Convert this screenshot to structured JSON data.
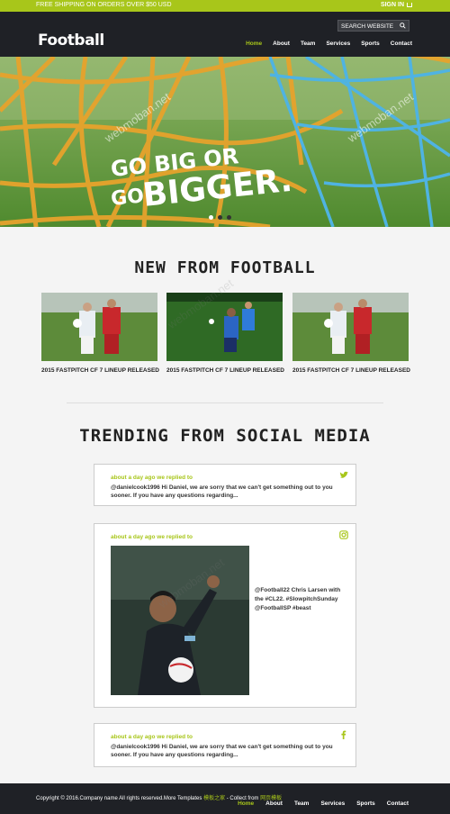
{
  "topbar": {
    "shipping": "FREE SHIPPING ON ORDERS OVER $50 USD",
    "signin": "SIGN IN"
  },
  "header": {
    "logo": "Football",
    "search_placeholder": "SEARCH WEBSITE",
    "nav": [
      "Home",
      "About",
      "Team",
      "Services",
      "Sports",
      "Contact"
    ]
  },
  "hero": {
    "line1": "GO BIG OR",
    "line2a": "GO",
    "line2b": "BIGGER."
  },
  "news": {
    "title": "NEW FROM FOOTBALL",
    "items": [
      {
        "caption": "2015 FASTPITCH CF 7 LINEUP RELEASED"
      },
      {
        "caption": "2015 FASTPITCH CF 7 LINEUP RELEASED"
      },
      {
        "caption": "2015 FASTPITCH CF 7 LINEUP RELEASED"
      }
    ]
  },
  "social": {
    "title": "TRENDING FROM SOCIAL MEDIA",
    "posts": [
      {
        "meta": "about a day ago we replied to",
        "text": "@danielcook1996 Hi Daniel, we are sorry that we can't get something out to you sooner. If you have any questions regarding...",
        "icon": "twitter-icon"
      },
      {
        "meta": "about a day ago we replied to",
        "text": "@Football22 Chris Larsen with the #CL22. #SlowpitchSunday @FootballSP #beast",
        "icon": "instagram-icon"
      },
      {
        "meta": "about a day ago we replied to",
        "text": "@danielcook1996 Hi Daniel, we are sorry that we can't get something out to you sooner. If you have any questions regarding...",
        "icon": "facebook-icon"
      }
    ]
  },
  "footer": {
    "copy": "Copyright © 2016.Company name All rights reserved.More Templates",
    "link1": "模板之家",
    "mid": " - Collect from",
    "link2": "网页模板",
    "nav": [
      "Home",
      "About",
      "Team",
      "Services",
      "Sports",
      "Contact"
    ]
  },
  "watermark": "webmoban.net",
  "colors": {
    "accent": "#a8c61a",
    "dark": "#1f2126"
  }
}
